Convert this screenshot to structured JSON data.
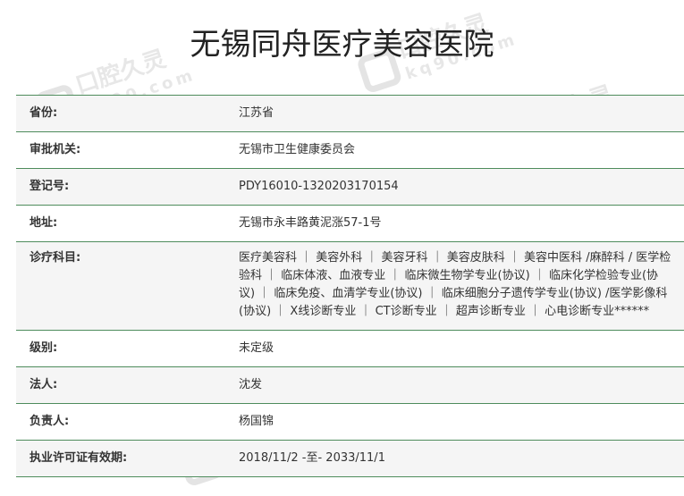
{
  "page": {
    "title": "无锡同舟医疗美容医院"
  },
  "watermark": {
    "brand": "口腔久灵",
    "domain": "kq90.com"
  },
  "rows": [
    {
      "label": "省份:",
      "value": "江苏省"
    },
    {
      "label": "审批机关:",
      "value": "无锡市卫生健康委员会"
    },
    {
      "label": "登记号:",
      "value": "PDY16010-1320203170154"
    },
    {
      "label": "地址:",
      "value": "无锡市永丰路黄泥涨57-1号"
    },
    {
      "label": "诊疗科目:",
      "value": "医疗美容科 ｜ 美容外科 ｜ 美容牙科 ｜ 美容皮肤科 ｜ 美容中医科 /麻醉科 / 医学检验科 ｜ 临床体液、血液专业 ｜ 临床微生物学专业(协议) ｜ 临床化学检验专业(协议) ｜ 临床免疫、血清学专业(协议) ｜ 临床细胞分子遗传学专业(协议) /医学影像科(协议) ｜ X线诊断专业 ｜ CT诊断专业 ｜ 超声诊断专业 ｜ 心电诊断专业******"
    },
    {
      "label": "级别:",
      "value": "未定级"
    },
    {
      "label": "法人:",
      "value": "沈发"
    },
    {
      "label": "负责人:",
      "value": "杨国锦"
    },
    {
      "label": "执业许可证有效期:",
      "value": "2018/11/2 -至- 2033/11/1"
    }
  ]
}
